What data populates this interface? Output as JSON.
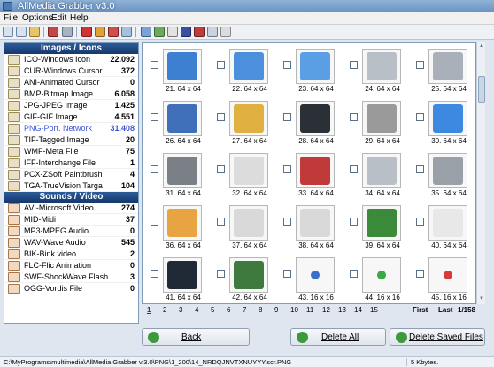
{
  "window": {
    "title": "AllMedia Grabber v3.0"
  },
  "menu": {
    "items": [
      "File",
      "Options",
      "Edit",
      "Help"
    ]
  },
  "left_panel": {
    "images_header": "Images / Icons",
    "images": [
      {
        "label": "ICO-Windows Icon",
        "count": "22.092"
      },
      {
        "label": "CUR-Windows Cursor",
        "count": "372"
      },
      {
        "label": "ANI-Animated Cursor",
        "count": "0"
      },
      {
        "label": "BMP-Bitmap Image",
        "count": "6.058"
      },
      {
        "label": "JPG-JPEG Image",
        "count": "1.425"
      },
      {
        "label": "GIF-GIF Image",
        "count": "4.551"
      },
      {
        "label": "PNG-Port. Network",
        "count": "31.408"
      },
      {
        "label": "TIF-Tagged Image",
        "count": "20"
      },
      {
        "label": "WMF-Meta File",
        "count": "75"
      },
      {
        "label": "IFF-Interchange File",
        "count": "1"
      },
      {
        "label": "PCX-ZSoft Paintbrush",
        "count": "4"
      },
      {
        "label": "TGA-TrueVision Targa",
        "count": "104"
      }
    ],
    "sounds_header": "Sounds / Video",
    "sounds": [
      {
        "label": "AVI-Microsoft Video",
        "count": "274"
      },
      {
        "label": "MID-Midi",
        "count": "37"
      },
      {
        "label": "MP3-MPEG Audio",
        "count": "0"
      },
      {
        "label": "WAV-Wave Audio",
        "count": "545"
      },
      {
        "label": "BIK-Bink video",
        "count": "2"
      },
      {
        "label": "FLC-Flic Animation",
        "count": "0"
      },
      {
        "label": "SWF-ShockWave Flash",
        "count": "3"
      },
      {
        "label": "OGG-Vordis File",
        "count": "0"
      }
    ],
    "selected_index": 6
  },
  "grid": {
    "cells": [
      {
        "caption": "21. 64 x 64",
        "icon": "blue-folder-icon",
        "color": "#3d7fd0"
      },
      {
        "caption": "22. 64 x 64",
        "icon": "blue-folder-icon",
        "color": "#4c8fdc"
      },
      {
        "caption": "23. 64 x 64",
        "icon": "blue-folder-icon",
        "color": "#5a9ee4"
      },
      {
        "caption": "24. 64 x 64",
        "icon": "usb-drive-icon",
        "color": "#b9bfc7"
      },
      {
        "caption": "25. 64 x 64",
        "icon": "wastebasket-icon",
        "color": "#a9b0ba"
      },
      {
        "caption": "26. 64 x 64",
        "icon": "monitor-window-icon",
        "color": "#3f6fb8"
      },
      {
        "caption": "27. 64 x 64",
        "icon": "certificate-icon",
        "color": "#e0b040"
      },
      {
        "caption": "28. 64 x 64",
        "icon": "floppy-disk-icon",
        "color": "#2b2f36"
      },
      {
        "caption": "29. 64 x 64",
        "icon": "house-icon",
        "color": "#9a9a9a"
      },
      {
        "caption": "30. 64 x 64",
        "icon": "globe-icon",
        "color": "#3d88e0"
      },
      {
        "caption": "31. 64 x 64",
        "icon": "database-icon",
        "color": "#7b7f86"
      },
      {
        "caption": "32. 64 x 64",
        "icon": "document-icon",
        "color": "#dcdcdc"
      },
      {
        "caption": "33. 64 x 64",
        "icon": "shield-icon",
        "color": "#c13a3a"
      },
      {
        "caption": "34. 64 x 64",
        "icon": "usb-drive-icon",
        "color": "#b9bfc7"
      },
      {
        "caption": "35. 64 x 64",
        "icon": "truck-icon",
        "color": "#9aa0a8"
      },
      {
        "caption": "36. 64 x 64",
        "icon": "cubes-icon",
        "color": "#e8a440"
      },
      {
        "caption": "37. 64 x 64",
        "icon": "document-pen-icon",
        "color": "#d9d9d9"
      },
      {
        "caption": "38. 64 x 64",
        "icon": "document-pen-icon",
        "color": "#d9d9d9"
      },
      {
        "caption": "39. 64 x 64",
        "icon": "globe-download-icon",
        "color": "#3a8a3a"
      },
      {
        "caption": "40. 64 x 64",
        "icon": "envelope-icon",
        "color": "#e8e8e8"
      },
      {
        "caption": "41. 64 x 64",
        "icon": "gauge-icon",
        "color": "#1f2a36"
      },
      {
        "caption": "42. 64 x 64",
        "icon": "chart-document-icon",
        "color": "#3e7a3e"
      },
      {
        "caption": "43. 16 x 16",
        "icon": "info-icon",
        "color": "#3a6fc9"
      },
      {
        "caption": "44. 16 x 16",
        "icon": "check-icon",
        "color": "#3aa845"
      },
      {
        "caption": "45. 16 x 16",
        "icon": "error-icon",
        "color": "#d83a3a"
      }
    ]
  },
  "pager": {
    "pages": [
      "1",
      "2",
      "3",
      "4",
      "5",
      "6",
      "7",
      "8",
      "9",
      "10",
      "11",
      "12",
      "13",
      "14",
      "15"
    ],
    "first": "First",
    "last": "Last",
    "page_count": "1/158"
  },
  "buttons": {
    "back": "Back",
    "delete_all": "Delete All",
    "delete_saved": "Delete Saved Files"
  },
  "status": {
    "path": "C:\\MyPrograms\\multimedia\\AllMedia Grabber v.3.0\\PNG\\1_200\\14_NRDQJNVTXNUYYY.scr.PNG",
    "size": "5 Kbytes."
  },
  "colors": {
    "selected_text": "#3a56d6",
    "section_header": "#15386b"
  }
}
